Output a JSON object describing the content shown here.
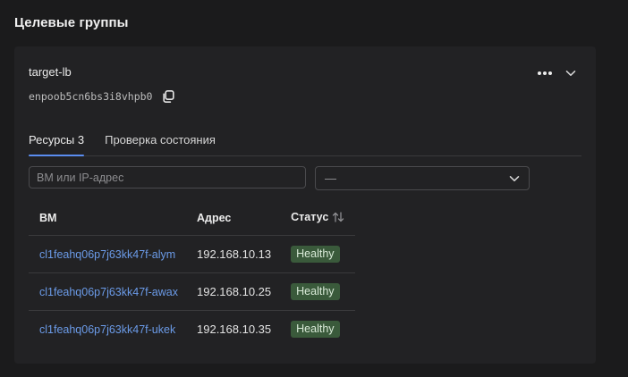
{
  "section": {
    "title": "Целевые группы"
  },
  "group": {
    "name": "target-lb",
    "id": "enpoob5cn6bs3i8vhpb0"
  },
  "tabs": [
    {
      "label": "Ресурсы 3",
      "active": true
    },
    {
      "label": "Проверка состояния",
      "active": false
    }
  ],
  "filters": {
    "search_placeholder": "ВМ или IP-адрес",
    "search_value": "",
    "select_value": "—"
  },
  "table": {
    "headers": {
      "vm": "ВМ",
      "address": "Адрес",
      "status": "Статус"
    },
    "rows": [
      {
        "vm": "cl1feahq06p7j63kk47f-alym",
        "address": "192.168.10.13",
        "status": "Healthy"
      },
      {
        "vm": "cl1feahq06p7j63kk47f-awax",
        "address": "192.168.10.25",
        "status": "Healthy"
      },
      {
        "vm": "cl1feahq06p7j63kk47f-ukek",
        "address": "192.168.10.35",
        "status": "Healthy"
      }
    ]
  },
  "icons": {
    "copy": "copy-icon",
    "more": "more-horizontal-icon",
    "expand": "chevron-down-icon",
    "select_arrow": "chevron-down-icon",
    "sort": "sort-arrows-icon"
  },
  "colors": {
    "accent": "#5a8df0",
    "link": "#6b9be8",
    "healthy_badge_bg": "#3a5a3b",
    "background": "#1b1b1c",
    "card": "#222224"
  }
}
